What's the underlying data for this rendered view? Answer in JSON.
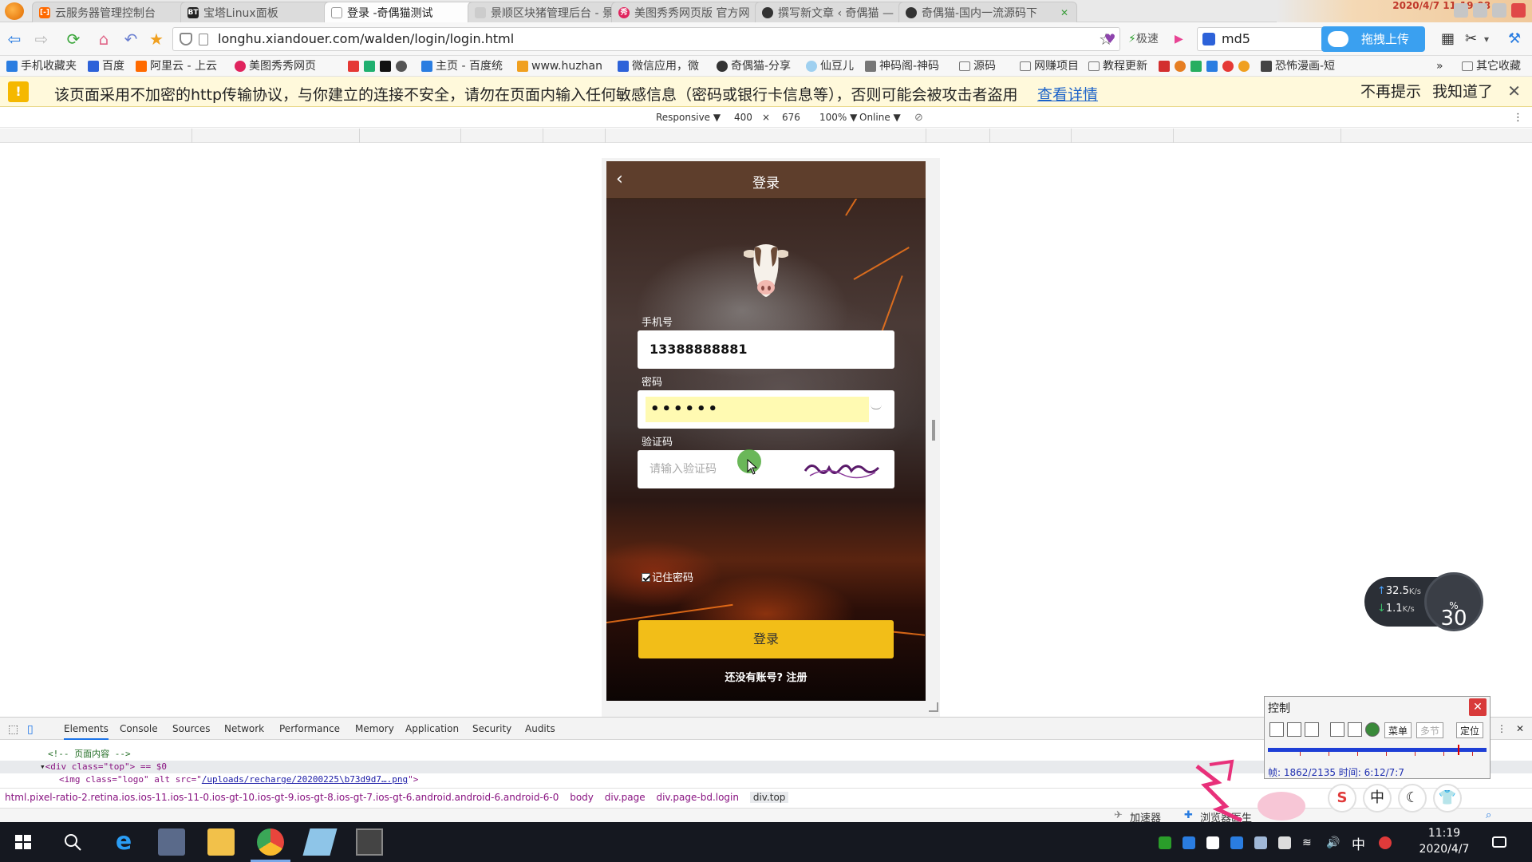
{
  "browser": {
    "tabs": [
      {
        "label": "云服务器管理控制台",
        "fav_color": "#ff6a00",
        "fav_text": "[-]"
      },
      {
        "label": "宝塔Linux面板",
        "fav_color": "#222222",
        "fav_text": "BT"
      },
      {
        "label": "登录 -奇偶猫测试",
        "fav_color": "#999999",
        "fav_text": ""
      },
      {
        "label": "景顺区块猪管理后台 - 景",
        "fav_color": "#cccccc",
        "fav_text": ""
      },
      {
        "label": "美图秀秀网页版 官方网",
        "fav_color": "#e0245e",
        "fav_text": "秀"
      },
      {
        "label": "撰写新文章 ‹ 奇偶猫 —",
        "fav_color": "#333333",
        "fav_text": ""
      },
      {
        "label": "奇偶猫-国内一流源码下",
        "fav_color": "#333333",
        "fav_text": ""
      }
    ],
    "datetime_deco": "2020/4/7 11:19:08",
    "url": "longhu.xiandouer.com/walden/login/login.html",
    "speed_mode": "极速",
    "search_value": "md5",
    "upload_label": "拖拽上传",
    "bookmarks": [
      "手机收藏夹",
      "百度",
      "阿里云 - 上云",
      "美图秀秀网页",
      "主页 - 百度统",
      "www.huzhan",
      "微信应用，微",
      "奇偶猫-分享",
      "仙豆儿",
      "神码阁-神码",
      "源码",
      "网赚项目",
      "教程更新",
      "恐怖漫画-短",
      "其它收藏"
    ]
  },
  "notice": {
    "message": "该页面采用不加密的http传输协议，与你建立的连接不安全，请勿在页面内输入任何敏感信息（密码或银行卡信息等），否则可能会被攻击者盗用",
    "detail_link": "查看详情",
    "dont_show": "不再提示",
    "got_it": "我知道了"
  },
  "device_toolbar": {
    "mode": "Responsive ▼",
    "width": "400",
    "times": "×",
    "height": "676",
    "zoom": "100% ▼",
    "network": "Online ▼"
  },
  "login_page": {
    "title": "登录",
    "phone_label": "手机号",
    "phone_value": "13388888881",
    "password_label": "密码",
    "password_mask": "••••••",
    "captcha_label": "验证码",
    "captcha_placeholder": "请输入验证码",
    "remember_label": "记住密码",
    "login_button": "登录",
    "register_text": "还没有账号? 注册"
  },
  "net_speed": {
    "up": "32.5",
    "up_unit": "K/s",
    "down": "1.1",
    "down_unit": "K/s",
    "percent": "30",
    "percent_unit": "%"
  },
  "devtools": {
    "tabs": [
      "Elements",
      "Console",
      "Sources",
      "Network",
      "Performance",
      "Memory",
      "Application",
      "Security",
      "Audits"
    ],
    "lines": {
      "comment": "<!-- 页面内容 -->",
      "div_open": "<div class=\"top\"> == $0",
      "img_prefix": "<img class=\"logo\" alt src=\"",
      "img_src": "/uploads/recharge/20200225\\b73d9d7….png",
      "img_suffix": "\">"
    },
    "breadcrumbs": [
      "html.pixel-ratio-2.retina.ios.ios-11.ios-11-0.ios-gt-10.ios-gt-9.ios-gt-8.ios-gt-7.ios-gt-6.android.android-6.android-6-0",
      "body",
      "div.page",
      "div.page-bd.login",
      "div.top"
    ]
  },
  "statusbar": {
    "accelerator": "加速器",
    "doctor": "浏览器医生"
  },
  "control_panel": {
    "title": "控制",
    "menu_btn": "菜单",
    "multi_btn": "多节",
    "locate_btn": "定位",
    "progress": 0.87,
    "frame_info": "帧: 1862/2135 时间: 6:12/7:7"
  },
  "taskbar": {
    "ime": "中",
    "time": "11:19",
    "date": "2020/4/7"
  }
}
